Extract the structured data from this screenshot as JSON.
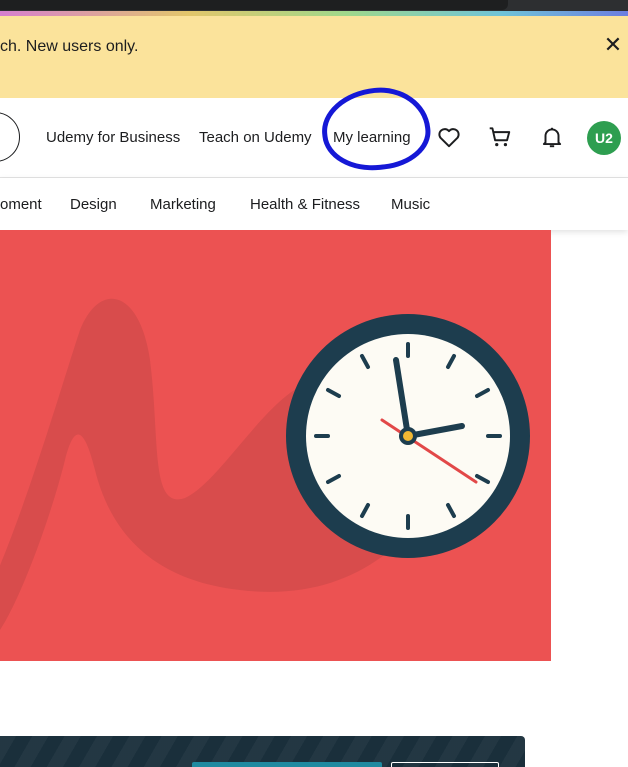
{
  "banner": {
    "text": "ch. New users only.",
    "close_glyph": "✕"
  },
  "header": {
    "links": [
      "Udemy for Business",
      "Teach on Udemy",
      "My learning"
    ],
    "icons": [
      "heart-icon",
      "cart-icon",
      "bell-icon"
    ],
    "avatar_initials": "U2"
  },
  "categories": [
    "oment",
    "Design",
    "Marketing",
    "Health & Fitness",
    "Music"
  ],
  "colors": {
    "banner_bg": "#fbe39b",
    "hero_bg": "#ec5252",
    "avatar_bg": "#2e9e50",
    "highlight_circle": "#1518d6",
    "bottom_banner_bg": "#1a2f3b"
  }
}
